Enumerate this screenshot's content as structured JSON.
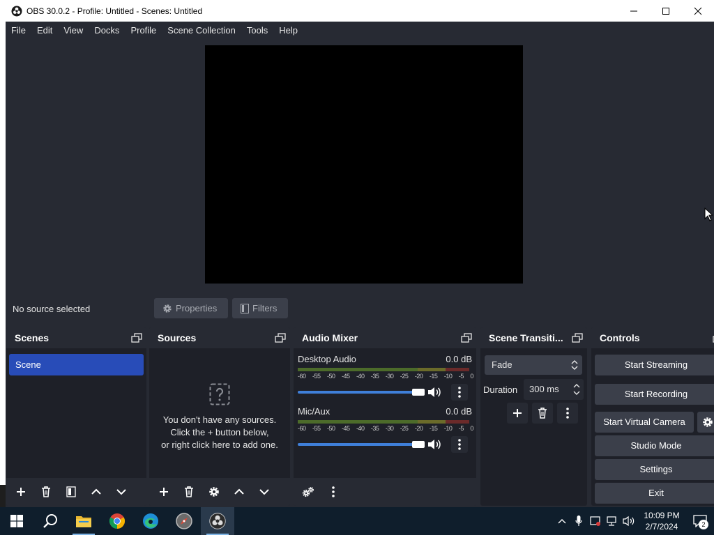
{
  "window": {
    "title": "OBS 30.0.2 - Profile: Untitled - Scenes: Untitled"
  },
  "menu": [
    "File",
    "Edit",
    "View",
    "Docks",
    "Profile",
    "Scene Collection",
    "Tools",
    "Help"
  ],
  "source_bar": {
    "status": "No source selected",
    "properties_label": "Properties",
    "filters_label": "Filters"
  },
  "scenes": {
    "title": "Scenes",
    "items": [
      "Scene"
    ]
  },
  "sources": {
    "title": "Sources",
    "empty_line1": "You don't have any sources.",
    "empty_line2": "Click the + button below,",
    "empty_line3": "or right click here to add one."
  },
  "audio_mixer": {
    "title": "Audio Mixer",
    "ticks": [
      "-60",
      "-55",
      "-50",
      "-45",
      "-40",
      "-35",
      "-30",
      "-25",
      "-20",
      "-15",
      "-10",
      "-5",
      "0"
    ],
    "channels": [
      {
        "name": "Desktop Audio",
        "level": "0.0 dB",
        "volume": 1.0
      },
      {
        "name": "Mic/Aux",
        "level": "0.0 dB",
        "volume": 1.0
      }
    ]
  },
  "transitions": {
    "title": "Scene Transiti...",
    "selected": "Fade",
    "duration_label": "Duration",
    "duration_value": "300 ms"
  },
  "controls": {
    "title": "Controls",
    "start_streaming": "Start Streaming",
    "start_recording": "Start Recording",
    "start_virtual_camera": "Start Virtual Camera",
    "studio_mode": "Studio Mode",
    "settings": "Settings",
    "exit": "Exit"
  },
  "taskbar": {
    "time": "10:09 PM",
    "date": "2/7/2024",
    "notification_count": "2"
  },
  "colors": {
    "accent_selected": "#284cb8",
    "panel": "#272a33",
    "dock_body": "#1e2028",
    "slider": "#3f7fd9"
  }
}
